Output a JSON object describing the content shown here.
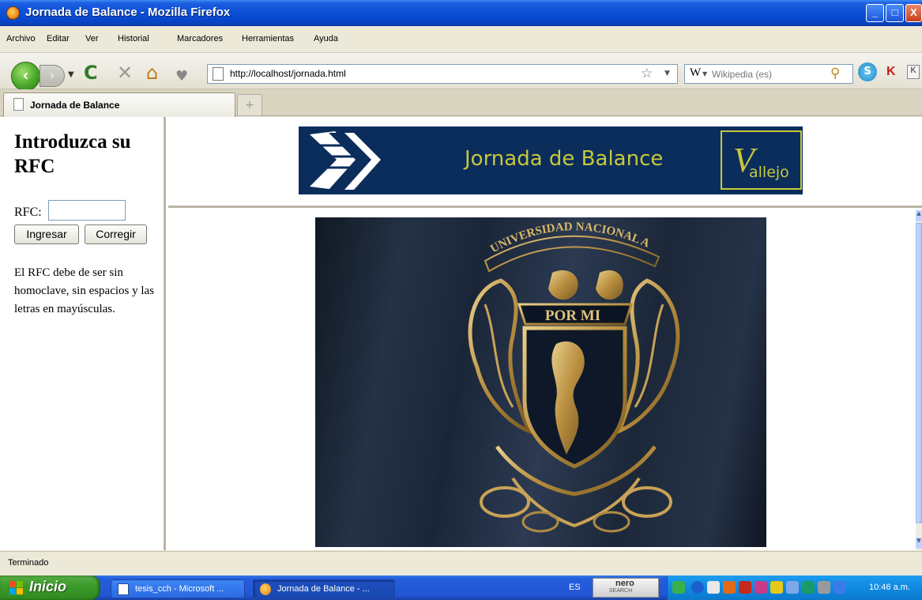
{
  "window": {
    "title": "Jornada de Balance - Mozilla Firefox",
    "controls": [
      "_",
      "□",
      "X"
    ]
  },
  "menu": {
    "items": [
      "Archivo",
      "Editar",
      "Ver",
      "Historial",
      "Marcadores",
      "Herramientas",
      "Ayuda"
    ]
  },
  "navbar": {
    "url": "http://localhost/jornada.html",
    "search_engine": "W",
    "search_placeholder": "Wikipedia (es)",
    "extension_label": "K"
  },
  "tabs": [
    {
      "label": "Jornada de Balance",
      "active": true
    }
  ],
  "left_frame": {
    "heading": "Introduzca su RFC",
    "rfc_label": "RFC:",
    "rfc_value": "",
    "ingresar_label": "Ingresar",
    "corregir_label": "Corregir",
    "note": "El RFC debe de ser sin homoclave, sin espacios y las letras en mayúsculas."
  },
  "banner": {
    "title": "Jornada de Balance",
    "logo_text": "allejo",
    "logo_mark": "V",
    "colors": {
      "background": "#0b2d5c",
      "accent": "#c7c83a"
    }
  },
  "main": {
    "image_description": "UNAM escudo flag",
    "crest_text_top": "UNIVERSIDAD NACIONAL AUTONOMA DE MEXICO",
    "crest_motto": "POR MI"
  },
  "status": {
    "text": "Terminado"
  },
  "taskbar": {
    "start_label": "Inicio",
    "tasks": [
      {
        "label": "tesis_cch - Microsoft ...",
        "icon": "word-icon",
        "active": false
      },
      {
        "label": "Jornada de Balance - ...",
        "icon": "firefox-icon",
        "active": true
      }
    ],
    "language": "ES",
    "nero_label": "nero",
    "nero_sub": "SEARCH",
    "clock": "10:46 a.m."
  }
}
